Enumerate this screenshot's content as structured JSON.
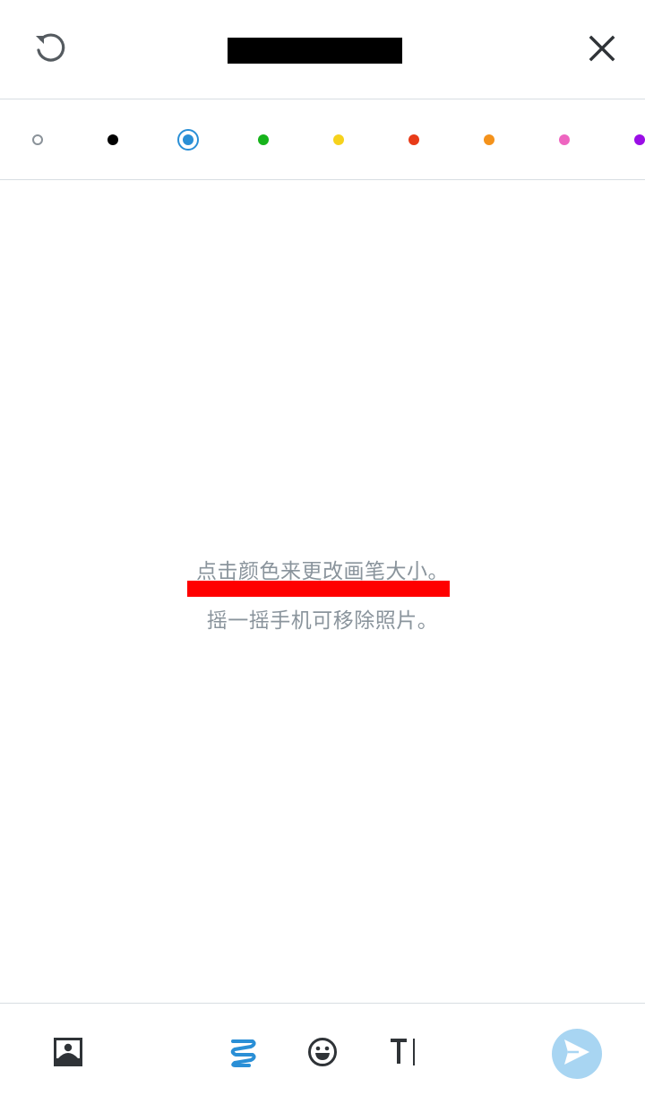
{
  "header": {
    "undo_icon": "undo-icon",
    "close_icon": "close-icon",
    "title_redacted": true
  },
  "palette": {
    "selected_index": 2,
    "colors": [
      {
        "name": "white",
        "hex": "#ffffff"
      },
      {
        "name": "black",
        "hex": "#000000"
      },
      {
        "name": "blue",
        "hex": "#2a8fd6"
      },
      {
        "name": "green",
        "hex": "#17b31b"
      },
      {
        "name": "yellow",
        "hex": "#f6d21c"
      },
      {
        "name": "red",
        "hex": "#e83b18"
      },
      {
        "name": "orange",
        "hex": "#f4921b"
      },
      {
        "name": "pink",
        "hex": "#ee65c0"
      },
      {
        "name": "purple",
        "hex": "#9a0ee6"
      }
    ]
  },
  "canvas": {
    "hint_line_1": "点击颜色来更改画笔大小。",
    "hint_line_2": "摇一摇手机可移除照片。",
    "highlight_color": "#ff0000"
  },
  "toolbar": {
    "items": [
      {
        "name": "image-icon"
      },
      {
        "name": "brush-icon",
        "active": true
      },
      {
        "name": "emoji-icon"
      },
      {
        "name": "text-tool-icon"
      }
    ],
    "send_icon": "send-icon",
    "accent": "#2a8fd6",
    "send_bg": "#a8d5f2"
  }
}
